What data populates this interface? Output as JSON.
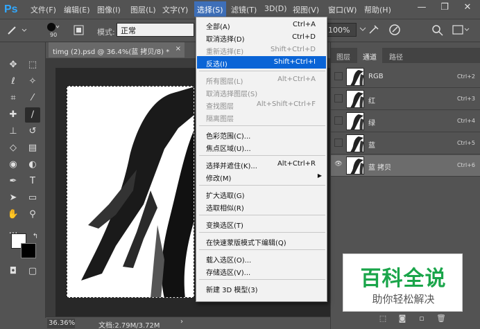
{
  "app": {
    "logo": "Ps"
  },
  "menubar": {
    "items": [
      "文件(F)",
      "编辑(E)",
      "图像(I)",
      "图层(L)",
      "文字(Y)",
      "选择(S)",
      "滤镜(T)",
      "3D(D)",
      "视图(V)",
      "窗口(W)",
      "帮助(H)"
    ],
    "active_index": 5,
    "window_controls": {
      "minimize": "—",
      "maximize": "❐",
      "close": "✕"
    }
  },
  "options_bar": {
    "brush_size": "90",
    "mode_label": "模式:",
    "mode_value": "正常",
    "zoom_value": "100%"
  },
  "document": {
    "tab_title": "timg (2).psd @ 36.4%(蓝 拷贝/8) *",
    "tab_close": "×"
  },
  "status_bar": {
    "zoom": "36.36%",
    "doc_info": "文档:2.79M/3.72M",
    "arrow": "›"
  },
  "select_menu": {
    "items": [
      {
        "label": "全部(A)",
        "shortcut": "Ctrl+A",
        "enabled": true
      },
      {
        "label": "取消选择(D)",
        "shortcut": "Ctrl+D",
        "enabled": true
      },
      {
        "label": "重新选择(E)",
        "shortcut": "Shift+Ctrl+D",
        "enabled": false
      },
      {
        "label": "反选(I)",
        "shortcut": "Shift+Ctrl+I",
        "enabled": true,
        "highlighted": true
      },
      {
        "separator": true
      },
      {
        "label": "所有图层(L)",
        "shortcut": "Alt+Ctrl+A",
        "enabled": false
      },
      {
        "label": "取消选择图层(S)",
        "shortcut": "",
        "enabled": false
      },
      {
        "label": "查找图层",
        "shortcut": "Alt+Shift+Ctrl+F",
        "enabled": false
      },
      {
        "label": "隔离图层",
        "shortcut": "",
        "enabled": false
      },
      {
        "separator": true
      },
      {
        "label": "色彩范围(C)...",
        "shortcut": "",
        "enabled": true
      },
      {
        "label": "焦点区域(U)...",
        "shortcut": "",
        "enabled": true
      },
      {
        "separator": true
      },
      {
        "label": "选择并遮住(K)...",
        "shortcut": "Alt+Ctrl+R",
        "enabled": true
      },
      {
        "label": "修改(M)",
        "shortcut": "",
        "enabled": true,
        "submenu": true
      },
      {
        "separator": true
      },
      {
        "label": "扩大选取(G)",
        "shortcut": "",
        "enabled": true
      },
      {
        "label": "选取相似(R)",
        "shortcut": "",
        "enabled": true
      },
      {
        "separator": true
      },
      {
        "label": "变换选区(T)",
        "shortcut": "",
        "enabled": true
      },
      {
        "separator": true
      },
      {
        "label": "在快速蒙版模式下编辑(Q)",
        "shortcut": "",
        "enabled": true
      },
      {
        "separator": true
      },
      {
        "label": "载入选区(O)...",
        "shortcut": "",
        "enabled": true
      },
      {
        "label": "存储选区(V)...",
        "shortcut": "",
        "enabled": true
      },
      {
        "separator": true
      },
      {
        "label": "新建 3D 模型(3)",
        "shortcut": "",
        "enabled": true
      }
    ]
  },
  "panels": {
    "tabs": [
      "图层",
      "通道",
      "路径"
    ],
    "active_tab": 1,
    "channels": [
      {
        "name": "RGB",
        "shortcut": "Ctrl+2",
        "visible": false,
        "selected": false
      },
      {
        "name": "红",
        "shortcut": "Ctrl+3",
        "visible": false,
        "selected": false
      },
      {
        "name": "绿",
        "shortcut": "Ctrl+4",
        "visible": false,
        "selected": false
      },
      {
        "name": "蓝",
        "shortcut": "Ctrl+5",
        "visible": false,
        "selected": false
      },
      {
        "name": "蓝 拷贝",
        "shortcut": "Ctrl+6",
        "visible": true,
        "selected": true
      }
    ]
  },
  "watermark": {
    "title": "百科全说",
    "subtitle": "助你轻松解决"
  },
  "colors": {
    "ui_bg": "#535353",
    "menu_highlight": "#0a64d6",
    "watermark_green": "#1aa54a",
    "ps_blue": "#31a8ff"
  }
}
